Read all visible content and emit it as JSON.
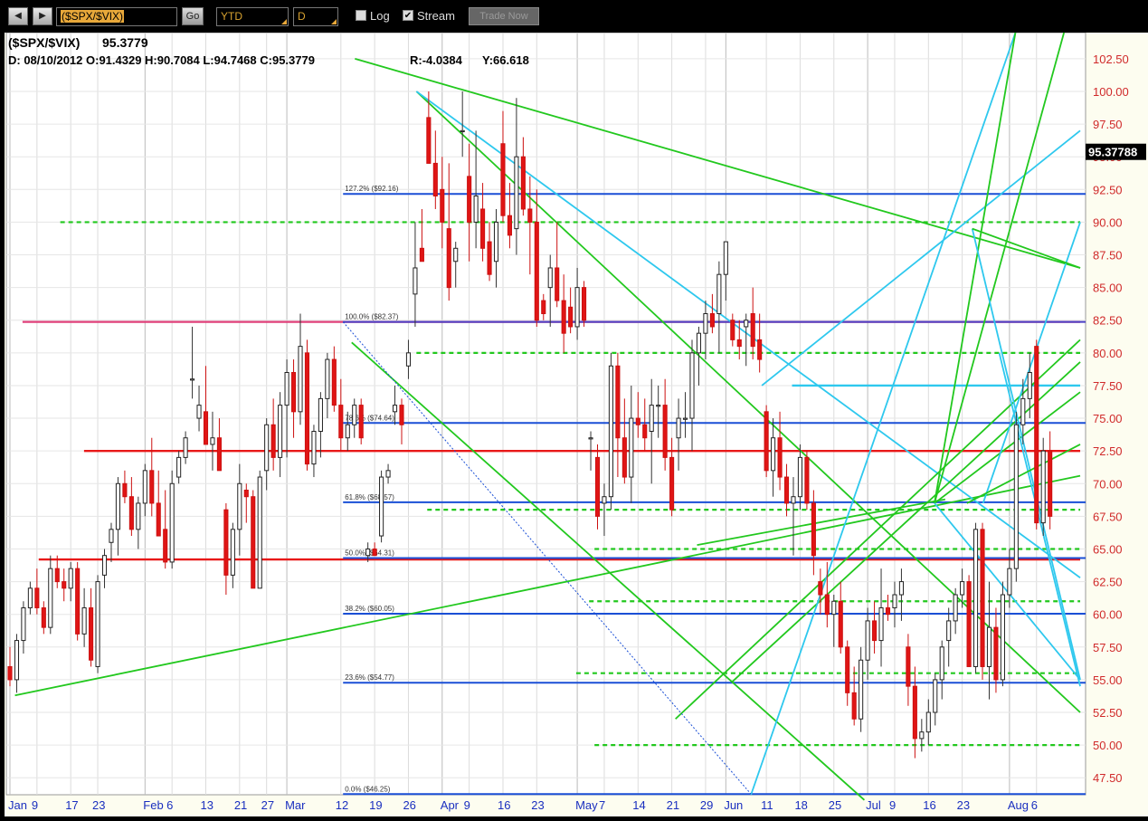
{
  "toolbar": {
    "back_icon": "triangle-left-icon",
    "forward_icon": "triangle-right-icon",
    "symbol": "($SPX/$VIX)",
    "go_label": "Go",
    "period": "YTD",
    "interval": "D",
    "log_label": "Log",
    "log_checked": false,
    "stream_label": "Stream",
    "stream_checked": true,
    "trade_label": "Trade Now"
  },
  "header": {
    "symbol": "($SPX/$VIX)",
    "last": "95.3779",
    "ohlc": "D: 08/10/2012 O:91.4329 H:90.7084 L:94.7468 C:95.3779",
    "r": "R:-4.0384",
    "y": "Y:66.618"
  },
  "price_tag": "95.37788",
  "chart_data": {
    "type": "candlestick",
    "ylim": [
      46.2,
      104.5
    ],
    "yticks": [
      "102.50",
      "100.00",
      "97.50",
      "95.00",
      "92.50",
      "90.00",
      "87.50",
      "85.00",
      "82.50",
      "80.00",
      "77.50",
      "75.00",
      "72.50",
      "70.00",
      "67.50",
      "65.00",
      "62.50",
      "60.00",
      "57.50",
      "55.00",
      "52.50",
      "50.00",
      "47.50"
    ],
    "xlabels": [
      {
        "text": "Jan",
        "month": true,
        "i": 0
      },
      {
        "text": "9",
        "i": 4
      },
      {
        "text": "17",
        "i": 9
      },
      {
        "text": "23",
        "i": 13
      },
      {
        "text": "Feb",
        "month": true,
        "i": 20
      },
      {
        "text": "6",
        "i": 24
      },
      {
        "text": "13",
        "i": 29
      },
      {
        "text": "21",
        "i": 34
      },
      {
        "text": "27",
        "i": 38
      },
      {
        "text": "Mar",
        "month": true,
        "i": 41
      },
      {
        "text": "12",
        "i": 49
      },
      {
        "text": "19",
        "i": 54
      },
      {
        "text": "26",
        "i": 59
      },
      {
        "text": "Apr",
        "month": true,
        "i": 64
      },
      {
        "text": "9",
        "i": 68
      },
      {
        "text": "16",
        "i": 73
      },
      {
        "text": "23",
        "i": 78
      },
      {
        "text": "May",
        "month": true,
        "i": 84
      },
      {
        "text": "7",
        "i": 88
      },
      {
        "text": "14",
        "i": 93
      },
      {
        "text": "21",
        "i": 98
      },
      {
        "text": "29",
        "i": 103
      },
      {
        "text": "Jun",
        "month": true,
        "i": 106
      },
      {
        "text": "11",
        "i": 112
      },
      {
        "text": "18",
        "i": 117
      },
      {
        "text": "25",
        "i": 122
      },
      {
        "text": "Jul",
        "month": true,
        "i": 127
      },
      {
        "text": "9",
        "i": 131
      },
      {
        "text": "16",
        "i": 136
      },
      {
        "text": "23",
        "i": 141
      },
      {
        "text": "Aug",
        "month": true,
        "i": 148
      },
      {
        "text": "6",
        "i": 152
      }
    ],
    "n_bars": 160,
    "candles": [
      [
        56.0,
        54.5,
        57.5,
        55.0
      ],
      [
        55.0,
        54.0,
        58.5,
        58.0
      ],
      [
        58.0,
        57.0,
        61.0,
        60.5
      ],
      [
        60.5,
        60.0,
        62.5,
        62.0
      ],
      [
        62.0,
        60.0,
        63.5,
        60.5
      ],
      [
        60.5,
        58.5,
        61.0,
        59.0
      ],
      [
        59.0,
        58.5,
        64.5,
        63.5
      ],
      [
        63.5,
        62.0,
        64.5,
        62.5
      ],
      [
        62.5,
        61.0,
        63.5,
        62.0
      ],
      [
        62.0,
        61.0,
        64.0,
        63.5
      ],
      [
        63.5,
        58.0,
        64.0,
        58.5
      ],
      [
        58.5,
        57.5,
        62.0,
        60.5
      ],
      [
        60.5,
        56.0,
        62.0,
        56.5
      ],
      [
        56.0,
        55.5,
        63.0,
        62.5
      ],
      [
        63.0,
        62.0,
        65.0,
        64.5
      ],
      [
        65.5,
        64.0,
        67.0,
        66.5
      ],
      [
        66.5,
        64.5,
        70.5,
        70.0
      ],
      [
        70.0,
        68.5,
        71.0,
        69.0
      ],
      [
        69.0,
        66.0,
        70.5,
        66.5
      ],
      [
        66.5,
        65.0,
        69.0,
        68.5
      ],
      [
        68.5,
        67.5,
        71.5,
        71.0
      ],
      [
        71.0,
        67.5,
        73.5,
        68.5
      ],
      [
        68.5,
        66.0,
        71.0,
        66.0
      ],
      [
        66.5,
        63.5,
        69.5,
        64.0
      ],
      [
        64.0,
        63.5,
        71.0,
        70.0
      ],
      [
        70.5,
        70.0,
        72.5,
        72.0
      ],
      [
        72.0,
        71.5,
        74.0,
        73.5
      ],
      [
        78.0,
        76.5,
        82.0,
        78.0
      ],
      [
        75.0,
        74.0,
        77.5,
        76.0
      ],
      [
        75.5,
        73.5,
        79.0,
        73.0
      ],
      [
        73.0,
        71.0,
        75.5,
        73.5
      ],
      [
        73.5,
        72.0,
        75.0,
        71.0
      ],
      [
        68.0,
        61.5,
        68.5,
        63.0
      ],
      [
        63.0,
        62.0,
        67.0,
        66.5
      ],
      [
        66.5,
        64.5,
        71.5,
        70.0
      ],
      [
        69.5,
        67.0,
        70.0,
        69.0
      ],
      [
        69.0,
        62.0,
        69.5,
        62.0
      ],
      [
        62.0,
        62.0,
        71.0,
        70.5
      ],
      [
        71.0,
        69.5,
        75.0,
        74.5
      ],
      [
        74.5,
        71.0,
        76.5,
        72.0
      ],
      [
        72.0,
        70.5,
        77.0,
        76.0
      ],
      [
        76.0,
        72.0,
        79.5,
        78.5
      ],
      [
        78.5,
        73.5,
        79.5,
        75.5
      ],
      [
        75.5,
        74.5,
        83.0,
        80.5
      ],
      [
        80.0,
        71.0,
        81.0,
        71.5
      ],
      [
        71.5,
        70.5,
        74.5,
        74.0
      ],
      [
        74.0,
        72.0,
        77.0,
        76.5
      ],
      [
        76.5,
        75.0,
        80.0,
        79.5
      ],
      [
        79.5,
        75.5,
        80.5,
        76.0
      ],
      [
        76.0,
        72.5,
        78.0,
        73.5
      ],
      [
        73.5,
        72.5,
        75.5,
        74.5
      ],
      [
        74.5,
        73.5,
        76.5,
        76.0
      ],
      [
        76.0,
        73.0,
        76.5,
        73.5
      ],
      [
        64.5,
        64.0,
        65.5,
        65.0
      ],
      [
        65.0,
        64.5,
        65.5,
        64.5
      ],
      [
        66.0,
        65.5,
        71.0,
        70.5
      ],
      [
        70.5,
        70.0,
        71.5,
        71.0
      ],
      [
        75.5,
        74.5,
        77.5,
        76.0
      ],
      [
        76.0,
        73.0,
        76.5,
        74.5
      ],
      [
        79.0,
        78.0,
        81.0,
        80.0
      ],
      [
        84.5,
        82.0,
        90.0,
        86.5
      ],
      [
        88.0,
        87.0,
        91.0,
        87.0
      ],
      [
        98.0,
        94.5,
        100.0,
        94.5
      ],
      [
        94.5,
        91.0,
        97.0,
        92.0
      ],
      [
        92.5,
        88.0,
        95.0,
        90.0
      ],
      [
        89.5,
        84.0,
        94.5,
        85.0
      ],
      [
        87.0,
        85.0,
        88.5,
        88.0
      ],
      [
        97.0,
        95.0,
        100.0,
        97.0
      ],
      [
        93.5,
        87.0,
        96.0,
        90.0
      ],
      [
        90.0,
        88.0,
        97.0,
        92.0
      ],
      [
        91.0,
        87.0,
        93.0,
        88.0
      ],
      [
        88.5,
        85.5,
        90.0,
        86.0
      ],
      [
        87.0,
        85.0,
        91.0,
        90.0
      ],
      [
        96.0,
        90.0,
        98.5,
        90.5
      ],
      [
        90.5,
        88.0,
        93.0,
        89.0
      ],
      [
        89.5,
        87.5,
        99.5,
        95.0
      ],
      [
        95.0,
        90.5,
        96.5,
        91.0
      ],
      [
        91.0,
        86.0,
        93.5,
        90.0
      ],
      [
        90.0,
        82.0,
        92.5,
        82.5
      ],
      [
        84.0,
        82.5,
        84.5,
        83.0
      ],
      [
        85.0,
        82.0,
        87.5,
        86.5
      ],
      [
        86.5,
        83.5,
        90.0,
        84.0
      ],
      [
        84.0,
        80.0,
        86.0,
        81.5
      ],
      [
        83.5,
        81.5,
        85.0,
        82.0
      ],
      [
        82.0,
        81.0,
        86.5,
        85.0
      ],
      [
        85.0,
        82.0,
        85.5,
        82.5
      ],
      [
        73.5,
        71.0,
        74.0,
        73.5
      ],
      [
        72.0,
        66.5,
        73.0,
        67.5
      ],
      [
        68.5,
        66.0,
        70.0,
        69.0
      ],
      [
        69.0,
        68.0,
        80.0,
        79.0
      ],
      [
        79.0,
        70.5,
        80.0,
        73.5
      ],
      [
        73.5,
        70.0,
        76.5,
        70.5
      ],
      [
        70.5,
        68.5,
        77.5,
        75.0
      ],
      [
        75.0,
        73.5,
        77.0,
        74.5
      ],
      [
        74.5,
        72.5,
        76.5,
        73.5
      ],
      [
        74.0,
        70.0,
        78.0,
        76.0
      ],
      [
        76.0,
        73.5,
        77.5,
        76.0
      ],
      [
        76.0,
        71.0,
        78.0,
        72.0
      ],
      [
        72.0,
        67.5,
        73.5,
        68.0
      ],
      [
        73.5,
        71.0,
        76.5,
        75.0
      ],
      [
        75.0,
        73.5,
        77.0,
        75.0
      ],
      [
        75.0,
        72.5,
        81.0,
        80.0
      ],
      [
        80.0,
        77.5,
        82.0,
        81.5
      ],
      [
        81.5,
        79.5,
        84.0,
        83.0
      ],
      [
        83.0,
        81.5,
        84.5,
        82.0
      ],
      [
        83.0,
        80.0,
        87.0,
        86.0
      ],
      [
        86.0,
        84.0,
        88.5,
        88.5
      ],
      [
        82.5,
        80.5,
        83.0,
        81.0
      ],
      [
        81.0,
        79.5,
        82.5,
        80.5
      ],
      [
        82.0,
        79.0,
        83.0,
        82.5
      ],
      [
        83.0,
        79.5,
        85.0,
        80.5
      ],
      [
        81.0,
        78.5,
        83.0,
        79.5
      ],
      [
        75.5,
        70.5,
        76.0,
        71.0
      ],
      [
        71.0,
        69.0,
        75.0,
        73.5
      ],
      [
        73.5,
        69.5,
        75.5,
        70.5
      ],
      [
        70.5,
        67.5,
        71.5,
        68.5
      ],
      [
        68.5,
        64.5,
        70.5,
        69.0
      ],
      [
        69.0,
        68.0,
        73.0,
        72.0
      ],
      [
        72.0,
        68.0,
        72.5,
        68.5
      ],
      [
        68.5,
        63.0,
        69.5,
        64.5
      ],
      [
        62.5,
        60.0,
        63.5,
        61.5
      ],
      [
        61.5,
        59.0,
        64.0,
        60.0
      ],
      [
        60.0,
        57.5,
        61.5,
        61.0
      ],
      [
        61.0,
        57.0,
        62.5,
        57.5
      ],
      [
        57.5,
        53.0,
        58.0,
        54.0
      ],
      [
        54.0,
        51.5,
        56.0,
        52.0
      ],
      [
        52.0,
        51.0,
        57.5,
        56.5
      ],
      [
        56.5,
        55.0,
        60.5,
        59.5
      ],
      [
        59.5,
        57.0,
        61.0,
        58.0
      ],
      [
        58.0,
        56.0,
        63.5,
        60.5
      ],
      [
        60.5,
        59.5,
        61.5,
        60.0
      ],
      [
        60.5,
        59.0,
        62.5,
        61.5
      ],
      [
        61.5,
        59.5,
        63.5,
        62.5
      ],
      [
        57.5,
        53.0,
        58.5,
        54.5
      ],
      [
        54.5,
        49.0,
        56.0,
        50.5
      ],
      [
        50.5,
        49.5,
        52.0,
        51.0
      ],
      [
        51.0,
        50.0,
        53.5,
        52.5
      ],
      [
        52.5,
        51.5,
        55.5,
        55.0
      ],
      [
        55.0,
        53.5,
        58.0,
        57.5
      ],
      [
        58.0,
        56.0,
        60.5,
        59.5
      ],
      [
        59.5,
        58.5,
        62.0,
        61.5
      ],
      [
        61.5,
        60.5,
        63.5,
        62.5
      ],
      [
        62.5,
        59.0,
        63.0,
        56.0
      ],
      [
        56.0,
        55.5,
        67.0,
        66.5
      ],
      [
        66.5,
        55.0,
        67.0,
        56.0
      ],
      [
        56.0,
        53.5,
        62.5,
        59.0
      ],
      [
        59.0,
        54.0,
        60.5,
        55.0
      ],
      [
        55.0,
        54.5,
        62.5,
        61.5
      ],
      [
        61.5,
        60.5,
        65.0,
        63.5
      ],
      [
        63.5,
        62.5,
        75.5,
        74.5
      ],
      [
        74.5,
        73.0,
        78.0,
        76.5
      ],
      [
        76.5,
        75.0,
        80.0,
        78.5
      ],
      [
        80.5,
        66.5,
        81.0,
        67.0
      ],
      [
        67.0,
        66.0,
        73.5,
        72.5
      ],
      [
        72.5,
        66.5,
        74.0,
        67.5
      ]
    ],
    "fib_levels": [
      {
        "value": 92.16,
        "label": "127.2% ($92.16)",
        "color": "#1a4fd6",
        "x0": 0.312
      },
      {
        "value": 82.37,
        "label": "100.0% ($82.37)",
        "color": "#4b3fc4",
        "x0": 0.312
      },
      {
        "value": 74.64,
        "label": "78.6% ($74.64)",
        "color": "#1a4fd6",
        "x0": 0.312
      },
      {
        "value": 68.57,
        "label": "61.8% ($68.57)",
        "color": "#1a4fd6",
        "x0": 0.312
      },
      {
        "value": 64.31,
        "label": "50.0% ($64.31)",
        "color": "#1a4fd6",
        "x0": 0.312
      },
      {
        "value": 60.05,
        "label": "38.2% ($60.05)",
        "color": "#1a4fd6",
        "x0": 0.312
      },
      {
        "value": 54.77,
        "label": "23.6% ($54.77)",
        "color": "#1a4fd6",
        "x0": 0.312
      },
      {
        "value": 46.25,
        "label": "0.0% ($46.25)",
        "color": "#1a4fd6",
        "x0": 0.312
      }
    ]
  }
}
